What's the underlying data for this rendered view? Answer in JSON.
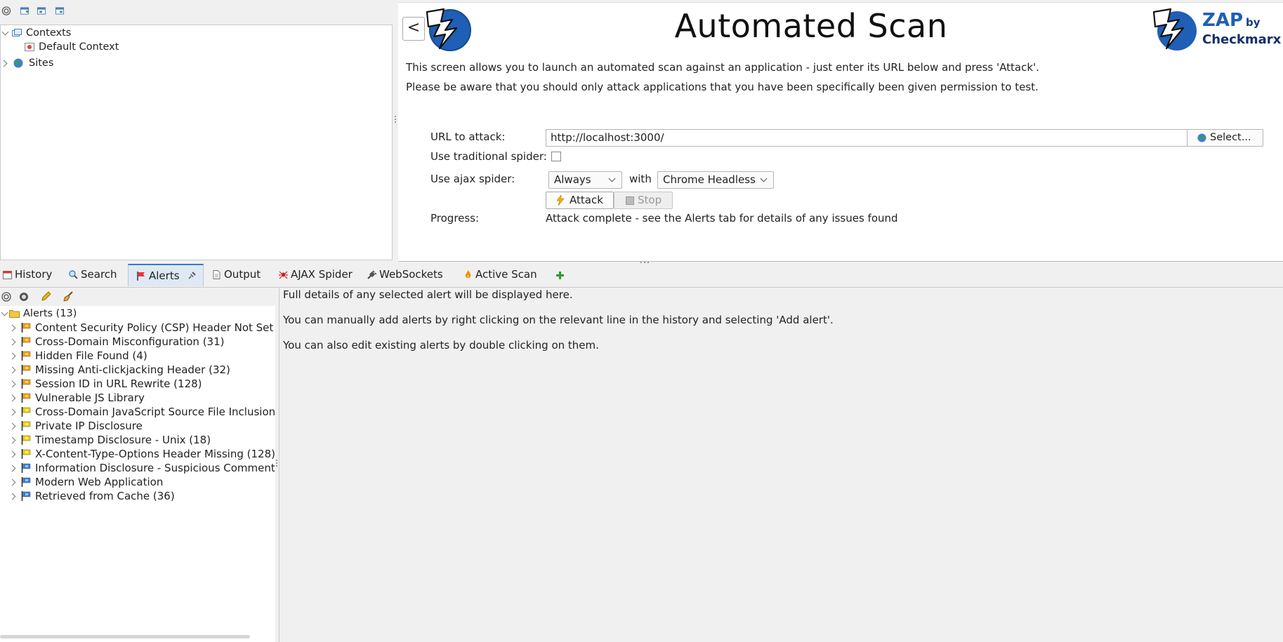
{
  "sites_tree": {
    "contexts_label": "Contexts",
    "default_context_label": "Default Context",
    "sites_label": "Sites"
  },
  "quick_start": {
    "back_label": "<",
    "title": "Automated Scan",
    "logo": {
      "brand": "ZAP",
      "by": "by",
      "company": "Checkmarx"
    },
    "description_1": "This screen allows you to launch an automated scan against  an application - just enter its URL below and press 'Attack'.",
    "description_2": "Please be aware that you should only attack applications that you have been specifically been given permission to test.",
    "url_label": "URL to attack:",
    "url_value": "http://localhost:3000/",
    "select_label": "Select...",
    "traditional_spider_label": "Use traditional spider:",
    "traditional_spider_checked": false,
    "ajax_spider_label": "Use ajax spider:",
    "ajax_mode": "Always",
    "with_label": "with",
    "browser": "Chrome Headless",
    "attack_label": "Attack",
    "stop_label": "Stop",
    "progress_label": "Progress:",
    "progress_value": "Attack complete - see the Alerts tab for details of any issues found"
  },
  "tabs": [
    {
      "label": "History",
      "icon": "calendar-icon",
      "active": false
    },
    {
      "label": "Search",
      "icon": "magnifier-icon",
      "active": false
    },
    {
      "label": "Alerts",
      "icon": "flag-icon",
      "active": true
    },
    {
      "label": "Output",
      "icon": "document-icon",
      "active": false
    },
    {
      "label": "AJAX Spider",
      "icon": "spider-icon",
      "active": false
    },
    {
      "label": "WebSockets",
      "icon": "plug-icon",
      "active": false
    },
    {
      "label": "Active Scan",
      "icon": "flame-icon",
      "active": false
    }
  ],
  "alerts": {
    "root_label": "Alerts (13)",
    "items": [
      {
        "label": "Content Security Policy (CSP) Header Not Set (",
        "risk": "medium"
      },
      {
        "label": "Cross-Domain Misconfiguration (31)",
        "risk": "medium"
      },
      {
        "label": "Hidden File Found (4)",
        "risk": "medium"
      },
      {
        "label": "Missing Anti-clickjacking Header (32)",
        "risk": "medium"
      },
      {
        "label": "Session ID in URL Rewrite (128)",
        "risk": "medium"
      },
      {
        "label": "Vulnerable JS Library",
        "risk": "medium"
      },
      {
        "label": "Cross-Domain JavaScript Source File Inclusion (",
        "risk": "low"
      },
      {
        "label": "Private IP Disclosure",
        "risk": "low"
      },
      {
        "label": "Timestamp Disclosure - Unix (18)",
        "risk": "low"
      },
      {
        "label": "X-Content-Type-Options Header Missing (128)",
        "risk": "low"
      },
      {
        "label": "Information Disclosure - Suspicious Comments",
        "risk": "info"
      },
      {
        "label": "Modern Web Application",
        "risk": "info"
      },
      {
        "label": "Retrieved from Cache (36)",
        "risk": "info"
      }
    ],
    "risk_colors": {
      "medium": "#f5a000",
      "low": "#f2d000",
      "info": "#3b7dd8"
    }
  },
  "details": {
    "line_1": "Full details of any selected alert will be displayed here.",
    "line_2": "You can manually add alerts by right clicking on the relevant line in the history and selecting 'Add alert'.",
    "line_3": "You can also edit existing alerts by double clicking on them."
  }
}
